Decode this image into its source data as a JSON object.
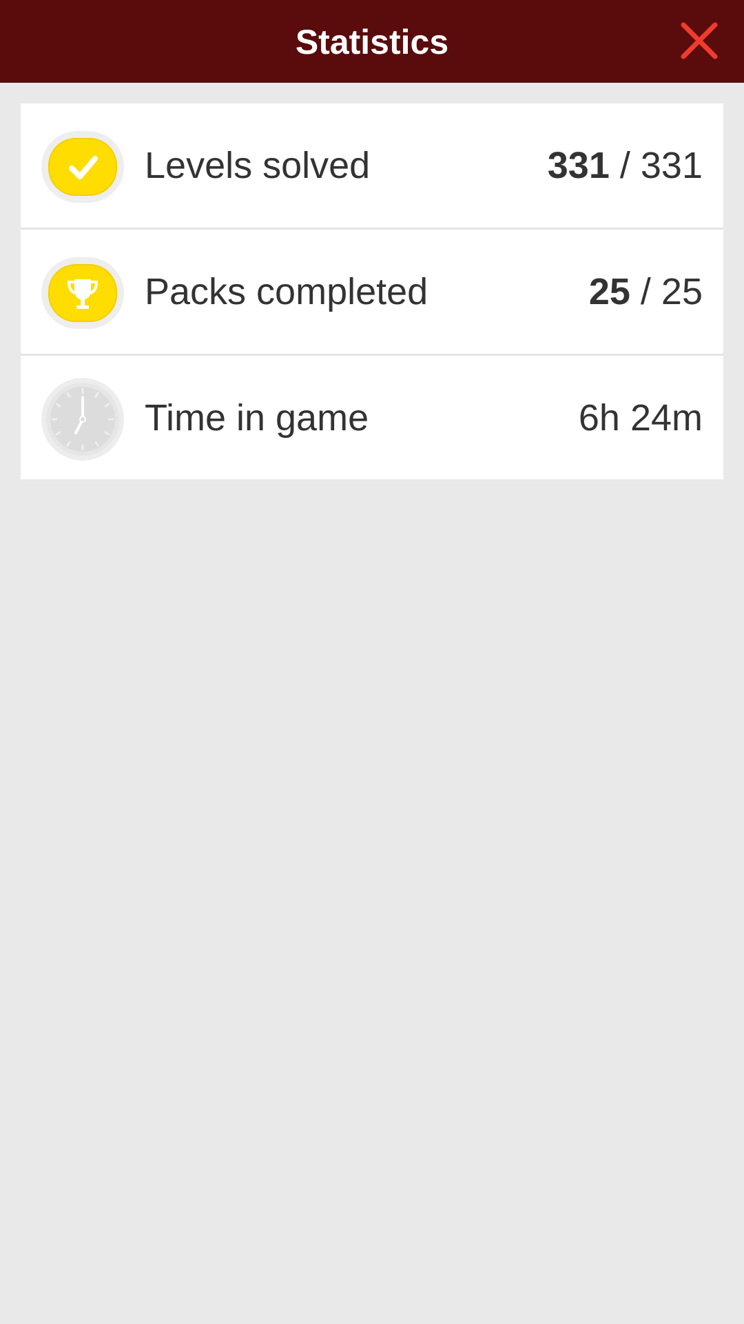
{
  "header": {
    "title": "Statistics",
    "background_color": "#5a0c0c",
    "close_icon": "close-icon",
    "close_icon_color": "#f03c2c"
  },
  "stats": {
    "levels": {
      "icon": "checkmark-icon",
      "label": "Levels solved",
      "value": "331",
      "separator": " / ",
      "total": "331"
    },
    "packs": {
      "icon": "trophy-icon",
      "label": "Packs completed",
      "value": "25",
      "separator": " / ",
      "total": "25"
    },
    "time": {
      "icon": "clock-icon",
      "label": "Time in game",
      "value": "6h 24m"
    }
  },
  "colors": {
    "badge_yellow": "#ffdd00",
    "page_background": "#e9e9e9",
    "text": "#333333"
  }
}
